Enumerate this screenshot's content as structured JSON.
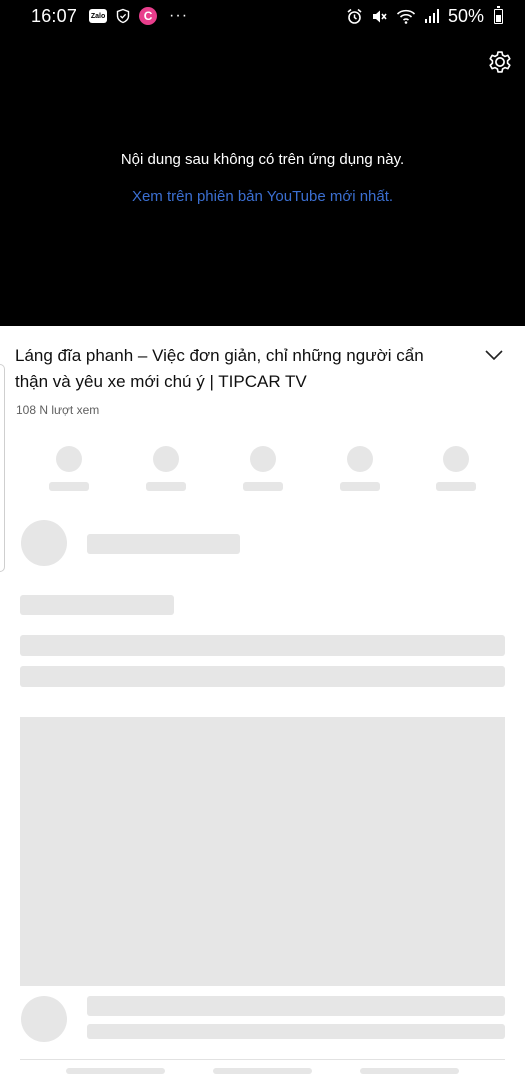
{
  "status_bar": {
    "time": "16:07",
    "left_icons": [
      "zalo-icon",
      "shield-icon",
      "c-app-icon",
      "more-icon"
    ],
    "zalo_label": "Zalo",
    "c_label": "C",
    "more_label": "···",
    "right_icons": [
      "alarm-icon",
      "mute-icon",
      "wifi-icon",
      "signal-icon",
      "battery-icon"
    ],
    "battery_percent": "50%"
  },
  "player": {
    "message": "Nội dung sau không có trên ứng dụng này.",
    "link": "Xem trên phiên bản YouTube mới nhất.",
    "settings_icon": "gear-icon"
  },
  "video": {
    "title": "Láng đĩa phanh – Việc đơn giản, chỉ những người cẩn thận và yêu xe mới chú ý | TIPCAR TV",
    "views": "108 N lượt xem",
    "expand_icon": "chevron-down-icon"
  },
  "colors": {
    "player_bg": "#000000",
    "link": "#3b6fd1",
    "skeleton": "#e6e6e6",
    "c_app": "#e83e8c"
  }
}
